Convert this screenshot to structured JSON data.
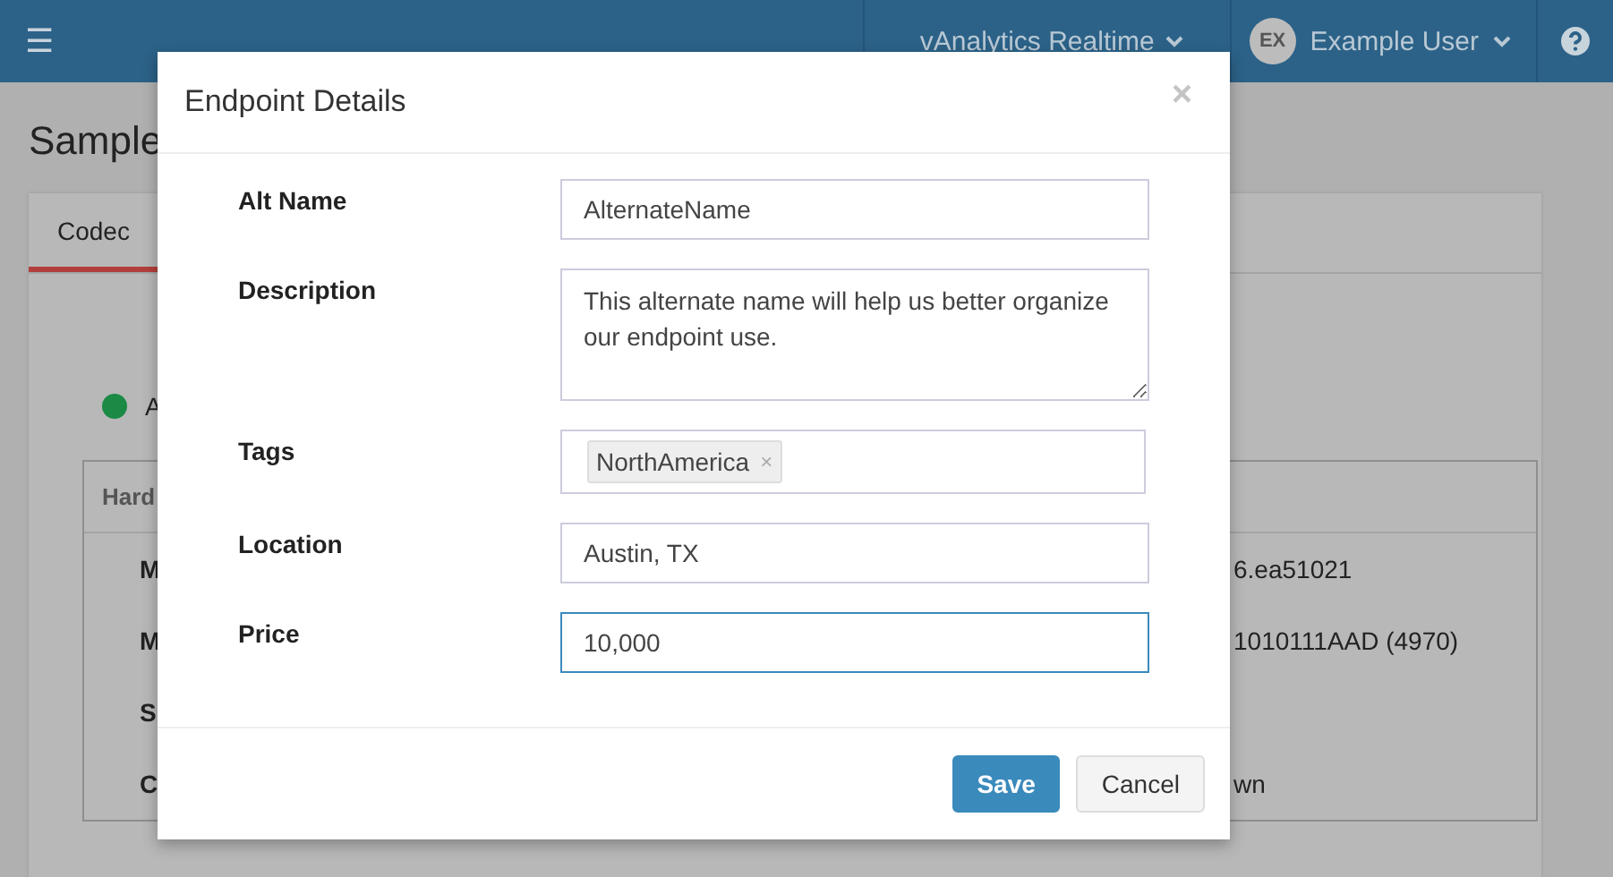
{
  "topbar": {
    "menu_icon": "☰",
    "product": "vAnalytics Realtime",
    "user_initials": "EX",
    "user_name": "Example User"
  },
  "page": {
    "title": "Sample",
    "tabs": [
      {
        "label": "Codec",
        "selected": true
      }
    ],
    "status": {
      "color": "#1a8a45",
      "label": "A"
    },
    "panel": {
      "header": "Hard",
      "rows": [
        {
          "label": "M",
          "value": "6.ea51021"
        },
        {
          "label": "M",
          "value": "1010111AAD (4970)"
        },
        {
          "label": "S",
          "value": ""
        },
        {
          "label": "C",
          "value": "wn"
        }
      ]
    }
  },
  "modal": {
    "title": "Endpoint Details",
    "close": "×",
    "fields": [
      {
        "kind": "text",
        "label": "Alt Name",
        "value": "AlternateName",
        "focused": false
      },
      {
        "kind": "textarea",
        "label": "Description",
        "value": "This alternate name will help us better organize our endpoint use.",
        "focused": false
      },
      {
        "kind": "tags",
        "label": "Tags",
        "tags": [
          {
            "label": "NorthAmerica",
            "remove": "×"
          }
        ],
        "focused": false
      },
      {
        "kind": "text",
        "label": "Location",
        "value": "Austin, TX",
        "focused": false
      },
      {
        "kind": "text",
        "label": "Price",
        "value": "10,000",
        "focused": true
      }
    ],
    "buttons": [
      {
        "label": "Save",
        "kind": "primary"
      },
      {
        "label": "Cancel",
        "kind": "default"
      }
    ]
  }
}
